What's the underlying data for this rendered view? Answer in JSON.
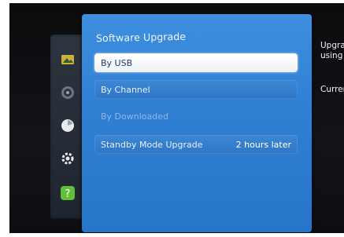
{
  "panel": {
    "title": "Software Upgrade",
    "items": [
      {
        "label": "By USB",
        "value": "",
        "state": "selected"
      },
      {
        "label": "By Channel",
        "value": "",
        "state": "normal"
      },
      {
        "label": "By Downloaded",
        "value": "",
        "state": "disabled"
      },
      {
        "label": "Standby Mode Upgrade",
        "value": "2 hours later",
        "state": "normal"
      }
    ]
  },
  "side_icons": [
    "picture-icon",
    "sound-icon",
    "broadcast-icon",
    "system-icon",
    "support-icon"
  ],
  "info_panel": {
    "line1": "Upgra",
    "line2": "using",
    "line3": "Curren"
  },
  "colors": {
    "panel_blue": "#2f7fd3",
    "highlight": "#ffffff",
    "support_green": "#5fbf3a"
  }
}
